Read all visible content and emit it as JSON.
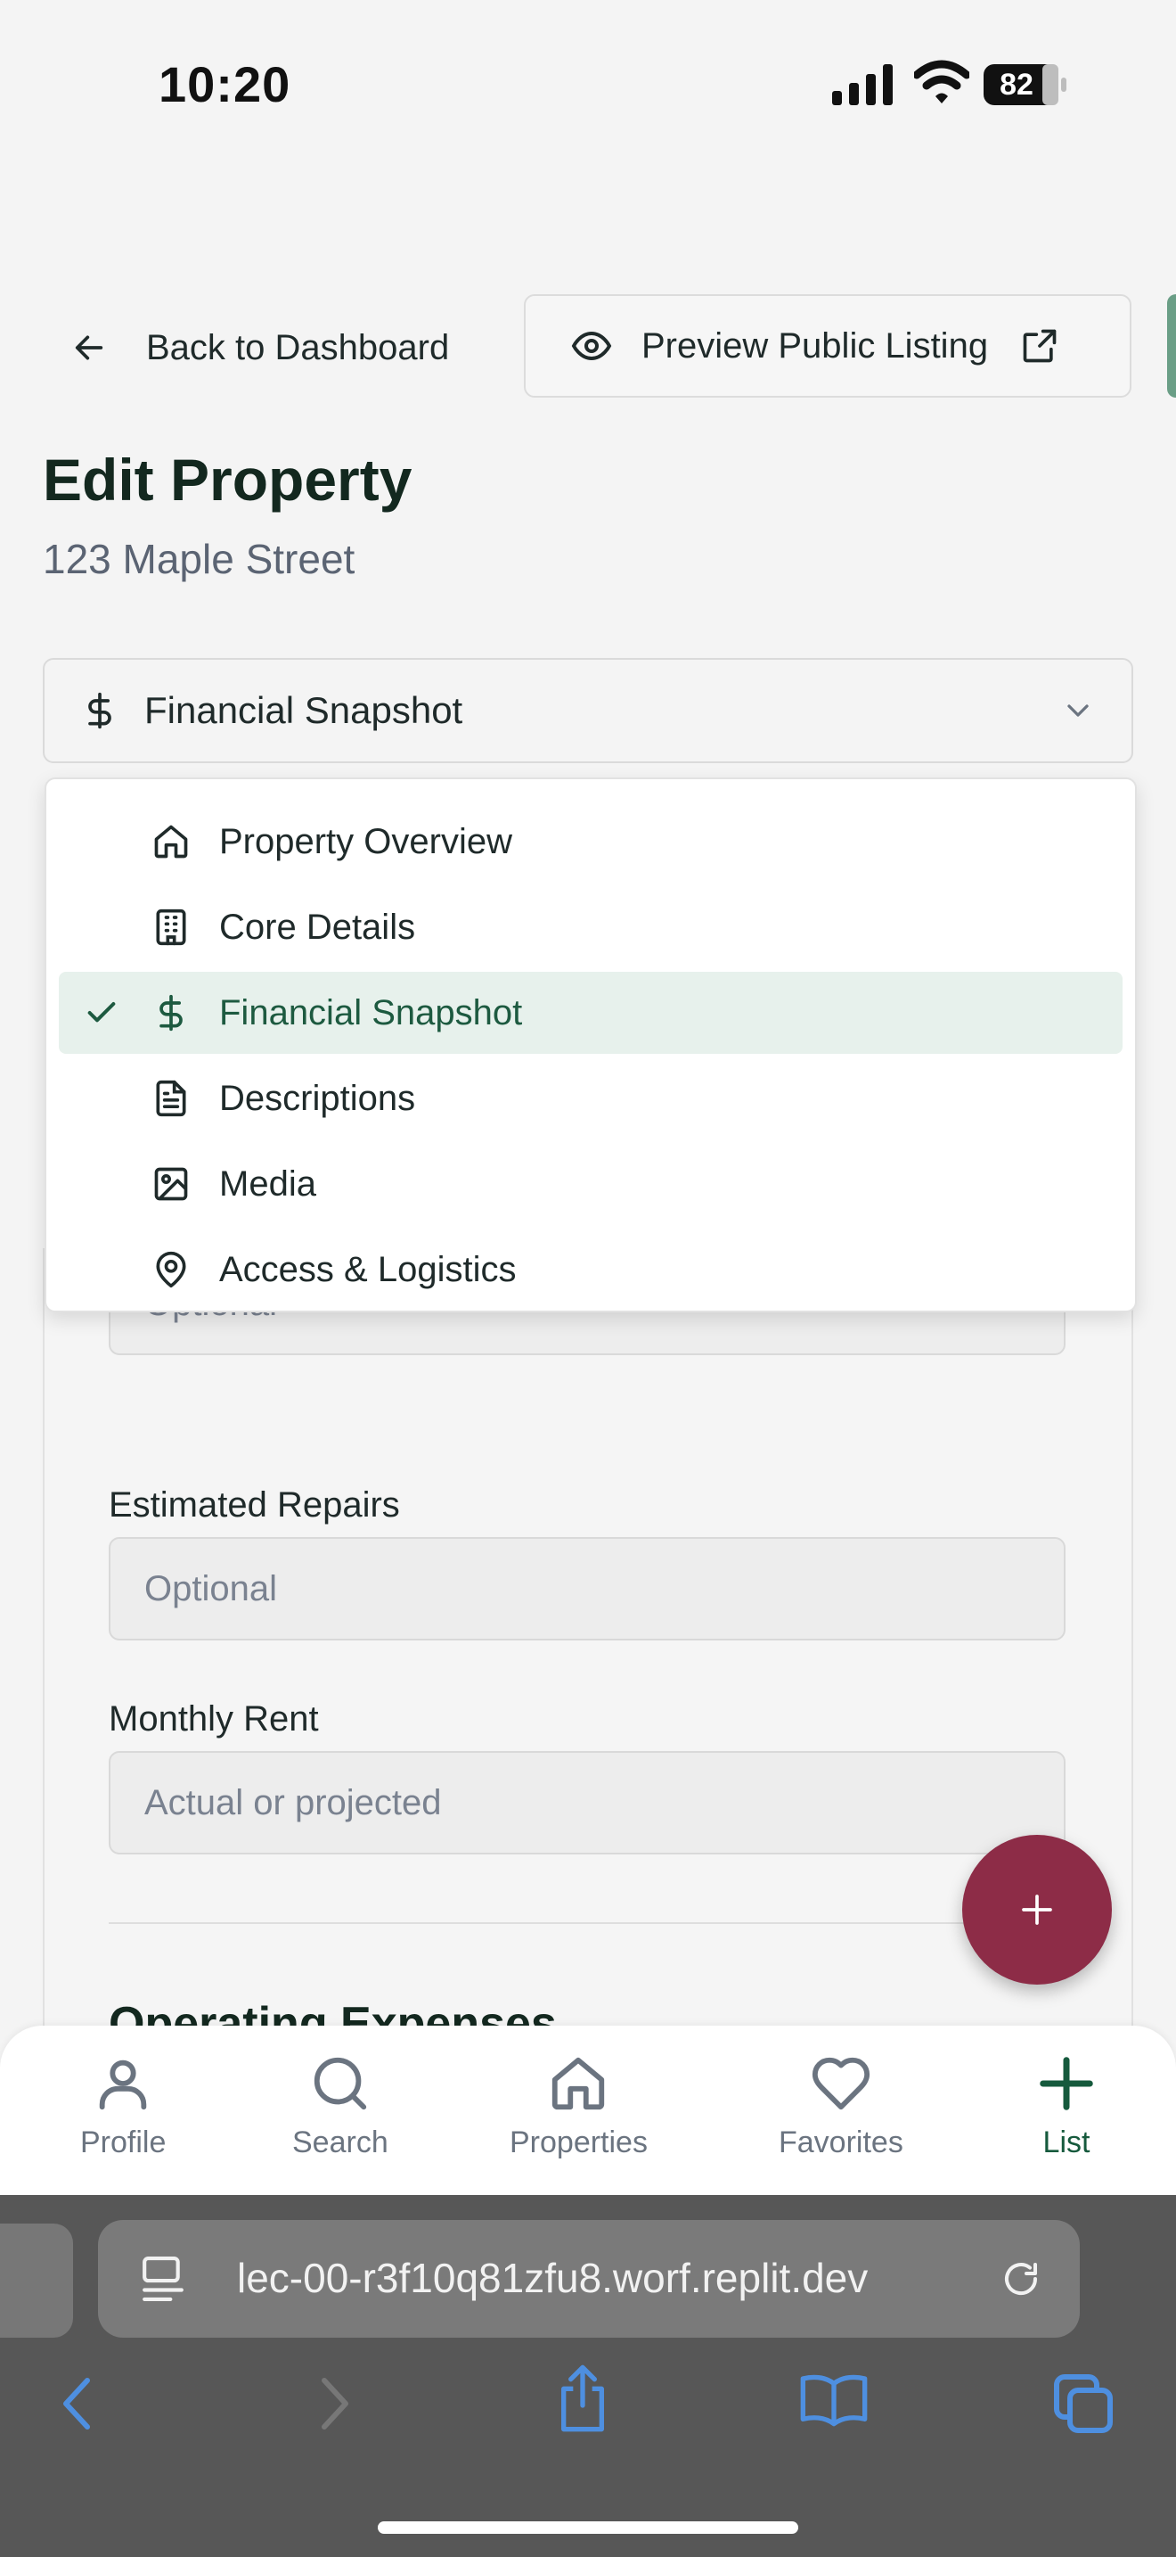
{
  "status_bar": {
    "time": "10:20",
    "battery": "82"
  },
  "header": {
    "back_label": "Back to Dashboard",
    "preview_label": "Preview Public Listing"
  },
  "page": {
    "title": "Edit Property",
    "subtitle": "123 Maple Street"
  },
  "section_select": {
    "selected": "Financial Snapshot",
    "options": [
      {
        "label": "Property Overview",
        "icon": "home-icon",
        "selected": false
      },
      {
        "label": "Core Details",
        "icon": "building-icon",
        "selected": false
      },
      {
        "label": "Financial Snapshot",
        "icon": "dollar-icon",
        "selected": true
      },
      {
        "label": "Descriptions",
        "icon": "document-icon",
        "selected": false
      },
      {
        "label": "Media",
        "icon": "image-icon",
        "selected": false
      },
      {
        "label": "Access & Logistics",
        "icon": "map-pin-icon",
        "selected": false
      }
    ]
  },
  "form": {
    "hidden_field_placeholder": "Optional",
    "estimated_repairs": {
      "label": "Estimated Repairs",
      "placeholder": "Optional"
    },
    "monthly_rent": {
      "label": "Monthly Rent",
      "placeholder": "Actual or projected"
    },
    "next_section_title": "Operating Expenses"
  },
  "bottom_nav": {
    "items": [
      {
        "label": "Profile",
        "icon": "user-icon",
        "active": false
      },
      {
        "label": "Search",
        "icon": "search-icon",
        "active": false
      },
      {
        "label": "Properties",
        "icon": "home-icon",
        "active": false
      },
      {
        "label": "Favorites",
        "icon": "heart-icon",
        "active": false
      },
      {
        "label": "List",
        "icon": "plus-icon",
        "active": true
      }
    ]
  },
  "browser": {
    "url": "lec-00-r3f10q81zfu8.worf.replit.dev"
  },
  "colors": {
    "brand_green": "#165a3d",
    "fab": "#8d2c47",
    "active_item_bg": "#e7f1ec"
  }
}
